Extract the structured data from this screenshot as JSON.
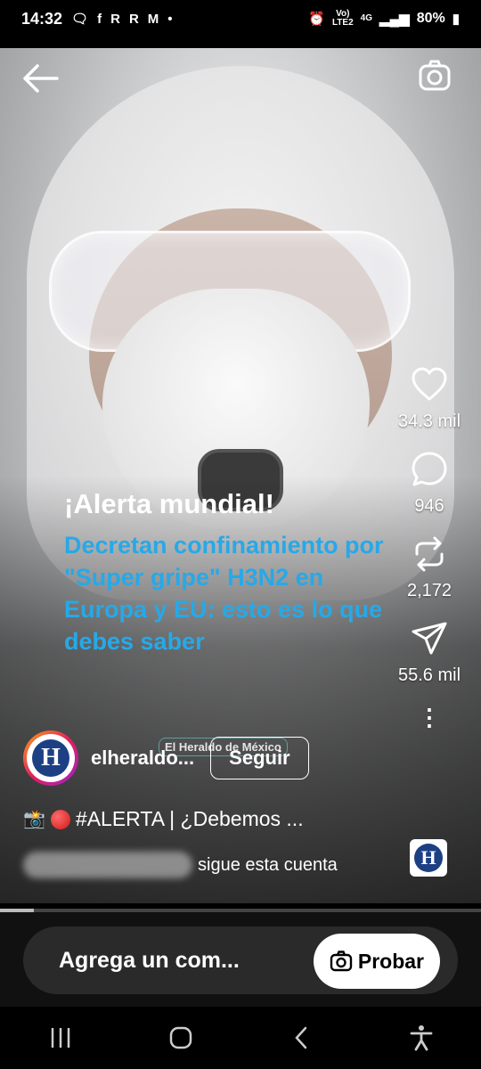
{
  "status_bar": {
    "time": "14:32",
    "left_icons": [
      "chat-bubble-icon",
      "facebook-icon",
      "r-icon",
      "r-icon",
      "gmail-icon",
      "dot-icon"
    ],
    "net_label_top": "Vo)",
    "net_label_bottom": "LTE2",
    "net_type": "4G",
    "battery": "80%"
  },
  "reel": {
    "headline_alert": "¡Alerta mundial!",
    "headline_body": "Decretan confinamiento por \"Super gripe\" H3N2 en Europa y EU: esto es lo que debes saber",
    "watermark": "El Heraldo de México"
  },
  "actions": {
    "likes": "34.3 mil",
    "comments": "946",
    "reposts": "2,172",
    "shares": "55.6 mil"
  },
  "account": {
    "logo_letter": "H",
    "username": "elheraldo...",
    "follow_label": "Seguir"
  },
  "caption": {
    "text": "#ALERTA | ¿Debemos ...",
    "follows_text": "sigue esta cuenta"
  },
  "progress": 0.07,
  "comment": {
    "placeholder": "Agrega un com...",
    "try_label": "Probar"
  },
  "colors": {
    "headline_accent": "#26a9e8",
    "brand_blue": "#1d3f84"
  }
}
